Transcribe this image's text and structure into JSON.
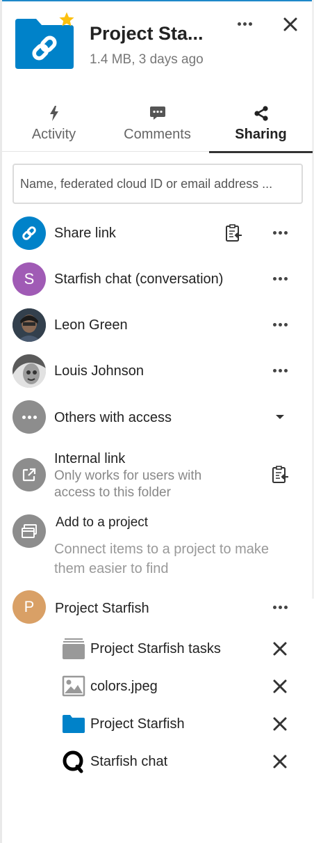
{
  "header": {
    "title": "Project Sta...",
    "subtitle": "1.4 MB, 3 days ago",
    "folder_icon": "link-folder-icon",
    "favorite_icon": "star-icon",
    "colors": {
      "folder": "#0082c9",
      "star": "#fcc00f"
    }
  },
  "tabs": [
    {
      "label": "Activity",
      "icon": "lightning-icon",
      "active": false
    },
    {
      "label": "Comments",
      "icon": "comment-icon",
      "active": false
    },
    {
      "label": "Sharing",
      "icon": "share-icon",
      "active": true
    }
  ],
  "search": {
    "placeholder": "Name, federated cloud ID or email address ..."
  },
  "shares": {
    "share_link": {
      "label": "Share link"
    },
    "chat": {
      "label": "Starfish chat (conversation)",
      "initial": "S",
      "color": "#a05bb5"
    },
    "leon": {
      "label": "Leon Green"
    },
    "louis": {
      "label": "Louis Johnson"
    },
    "others": {
      "label": "Others with access"
    },
    "internal": {
      "label": "Internal link",
      "description": "Only works for users with access to this folder"
    }
  },
  "projects": {
    "add_label": "Add to a project",
    "add_description": "Connect items to a project to make them easier to find",
    "project": {
      "label": "Project Starfish",
      "initial": "P",
      "color": "#d9a066"
    },
    "items": [
      {
        "label": "Project Starfish tasks",
        "icon": "deck-icon"
      },
      {
        "label": "colors.jpeg",
        "icon": "image-icon"
      },
      {
        "label": "Project Starfish",
        "icon": "folder-icon"
      },
      {
        "label": "Starfish chat",
        "icon": "talk-icon"
      }
    ]
  }
}
